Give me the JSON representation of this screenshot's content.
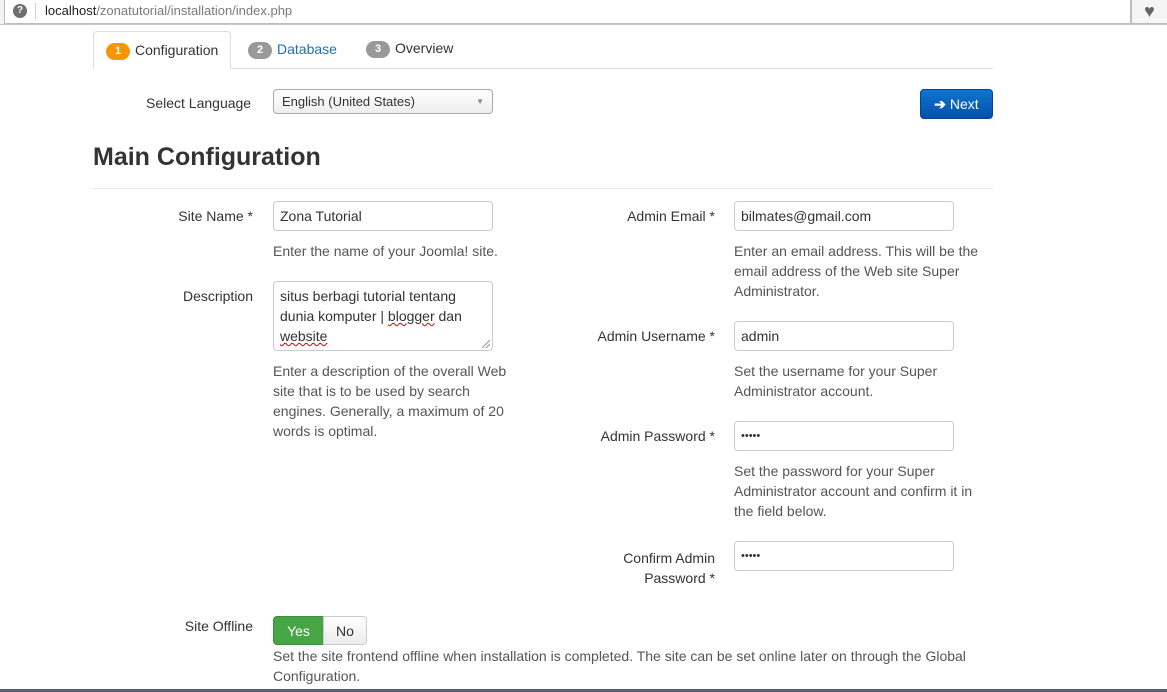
{
  "browser": {
    "url_host": "localhost",
    "url_path": "/zonatutorial/installation/index.php",
    "site_icon": "globe-icon",
    "bookmark_icon": "heart-icon"
  },
  "tabs": [
    {
      "number": "1",
      "label": "Configuration",
      "active": true,
      "badge_color": "#f89406"
    },
    {
      "number": "2",
      "label": "Database",
      "active": false,
      "badge_color": "#999999"
    },
    {
      "number": "3",
      "label": "Overview",
      "active": false,
      "badge_color": "#999999"
    }
  ],
  "language": {
    "label": "Select Language",
    "selected": "English (United States)"
  },
  "next_button": {
    "label": "Next",
    "icon": "arrow-right-icon"
  },
  "section_title": "Main Configuration",
  "form": {
    "site_name": {
      "label": "Site Name *",
      "value": "Zona Tutorial",
      "help": "Enter the name of your Joomla! site."
    },
    "description": {
      "label": "Description",
      "value_line1": "situs berbagi tutorial tentang",
      "value_line2a": "dunia komputer | ",
      "value_line2b": "blogger",
      "value_line2c": " dan",
      "value_line3": "website",
      "help": "Enter a description of the overall Web site that is to be used by search engines. Generally, a maximum of 20 words is optimal."
    },
    "admin_email": {
      "label": "Admin Email *",
      "value": "bilmates@gmail.com",
      "help": "Enter an email address. This will be the email address of the Web site Super Administrator."
    },
    "admin_username": {
      "label": "Admin Username *",
      "value": "admin",
      "help": "Set the username for your Super Administrator account."
    },
    "admin_password": {
      "label": "Admin Password *",
      "value": "•••••",
      "help": "Set the password for your Super Administrator account and confirm it in the field below."
    },
    "confirm_password": {
      "label_line1": "Confirm Admin",
      "label_line2": "Password *",
      "value": "•••••"
    },
    "site_offline": {
      "label": "Site Offline",
      "yes_label": "Yes",
      "no_label": "No",
      "selected": "Yes",
      "help": "Set the site frontend offline when installation is completed. The site can be set online later on through the Global Configuration."
    }
  },
  "colors": {
    "primary": "#0b62c4",
    "success": "#46a546",
    "active_badge": "#f89406",
    "inactive_badge": "#999999",
    "link": "#1f6fb5"
  }
}
